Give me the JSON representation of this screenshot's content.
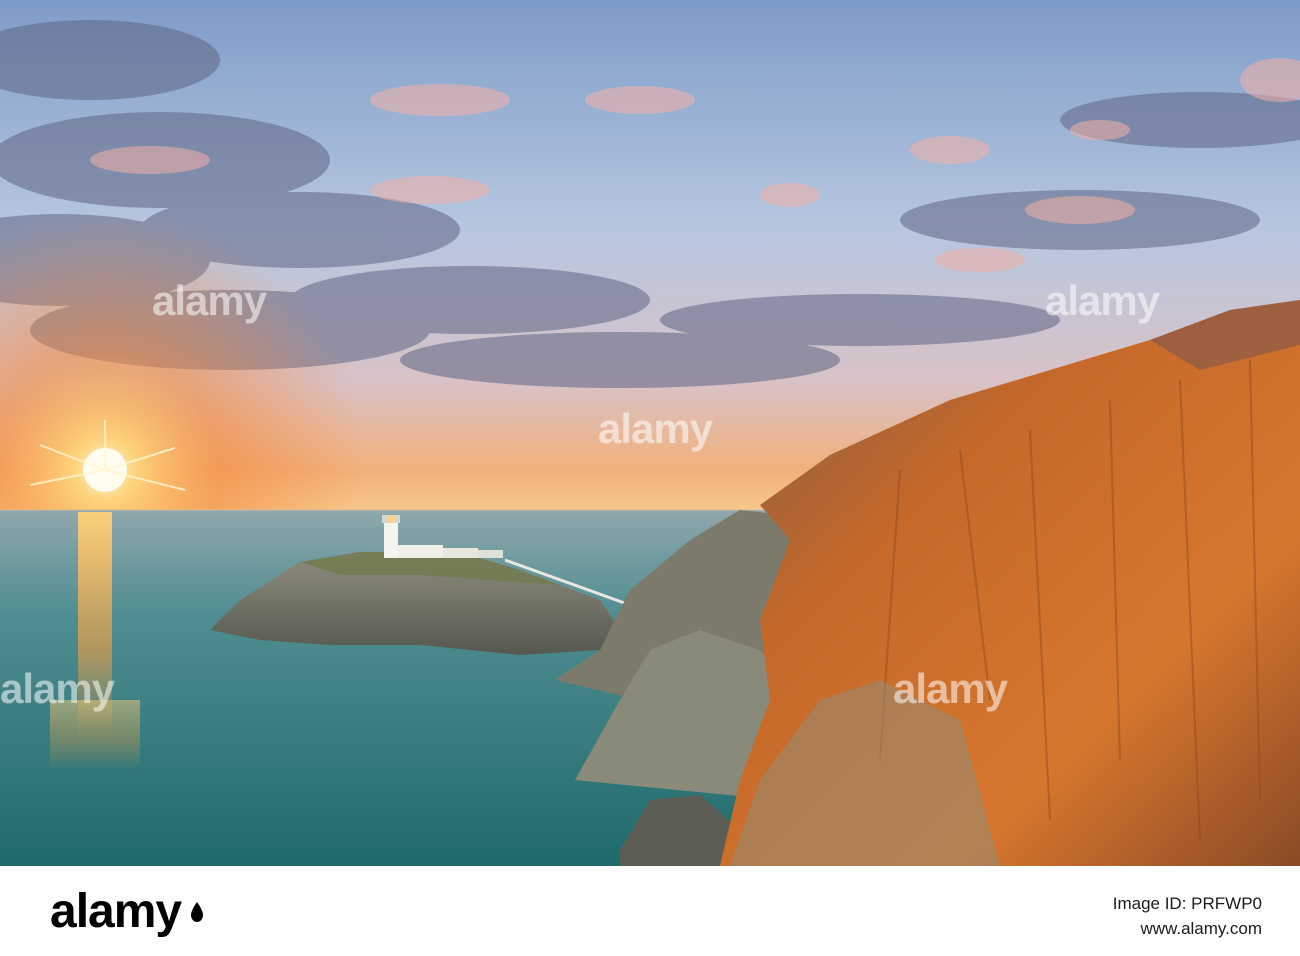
{
  "photo": {
    "subject": "Lighthouse on a rocky islet beside tall orange sea cliffs at sunset",
    "colors": {
      "sky_top": "#6f8fbf",
      "sky_glow": "#f59a3d",
      "sun": "#fff4c2",
      "sea": "#2f7a7a",
      "cliff": "#c96a2a",
      "lighthouse": "#f5f5f0"
    }
  },
  "watermark": {
    "word": "alamy"
  },
  "footer": {
    "logo": "alamy",
    "image_id": "Image ID: PRFWP0",
    "url": "www.alamy.com"
  }
}
